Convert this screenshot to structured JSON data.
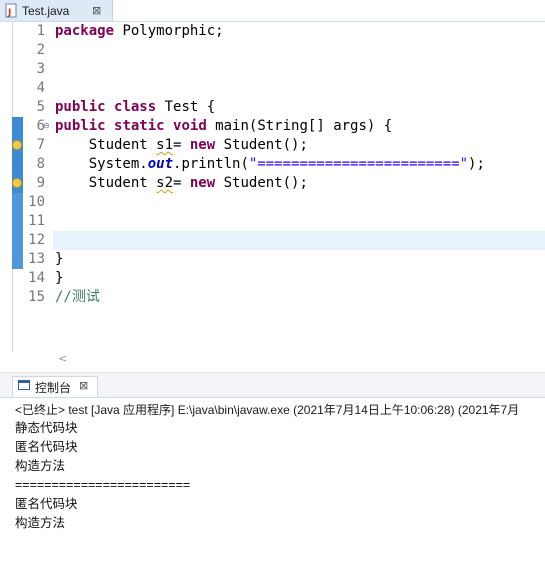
{
  "editor": {
    "tab": {
      "label": "Test.java",
      "close_icon": "close-icon"
    },
    "line_numbers": [
      "1",
      "2",
      "3",
      "4",
      "5",
      "6",
      "7",
      "8",
      "9",
      "10",
      "11",
      "12",
      "13",
      "14",
      "15"
    ],
    "code": {
      "l1_kw": "package",
      "l1_rest": " Polymorphic;",
      "l5_kw1": "public",
      "l5_kw2": "class",
      "l5_rest": " Test {",
      "l6_kw1": "public",
      "l6_kw2": "static",
      "l6_kw3": "void",
      "l6_a": " main(String[] ",
      "l6_args": "args",
      "l6_b": ") {",
      "l7_a": "    Student ",
      "l7_var": "s1",
      "l7_b": "= ",
      "l7_kw": "new",
      "l7_c": " Student();",
      "l8_a": "    System.",
      "l8_field": "out",
      "l8_b": ".println(",
      "l8_str": "\"========================\"",
      "l8_c": ");",
      "l9_a": "    Student ",
      "l9_var": "s2",
      "l9_b": "= ",
      "l9_kw": "new",
      "l9_c": " Student();",
      "l13": "}",
      "l14": "}",
      "l15_comment": "//测试"
    }
  },
  "console": {
    "tab_label": "控制台",
    "status": "<已终止> test [Java 应用程序] E:\\java\\bin\\javaw.exe  (2021年7月14日上午10:06:28)  (2021年7月",
    "output": [
      "静态代码块",
      "匿名代码块",
      "构造方法",
      "========================",
      "匿名代码块",
      "构造方法"
    ]
  }
}
